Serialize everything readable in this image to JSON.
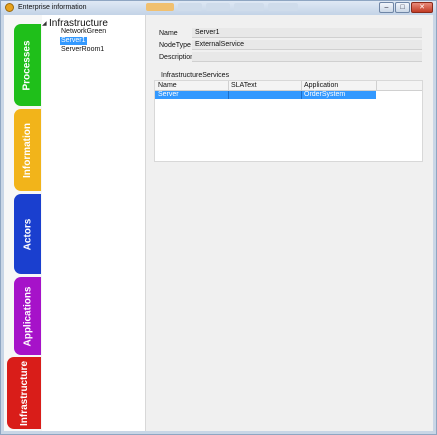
{
  "window": {
    "title": "Enterprise information",
    "icon": "app-icon",
    "controls": {
      "minimize": "–",
      "maximize": "□",
      "close": "✕"
    },
    "colors": {
      "titlebar": "#c9d6e6",
      "close": "#c23b24"
    }
  },
  "sidebar": {
    "tabs": [
      {
        "label": "Processes",
        "color": "#1fbf1a"
      },
      {
        "label": "Information",
        "color": "#f2b41a"
      },
      {
        "label": "Actors",
        "color": "#1a3fcf"
      },
      {
        "label": "Applications",
        "color": "#a612c9"
      },
      {
        "label": "Infrastructure",
        "color": "#d91d19"
      }
    ],
    "active_tab": "Infrastructure"
  },
  "tree": {
    "root": "Infrastructure",
    "expand_icon": "expanded-triangle-icon",
    "children": [
      "NetworkGreen",
      "Server1",
      "ServerRoom1"
    ],
    "selected": "Server1"
  },
  "details": {
    "fields": [
      {
        "label": "Name",
        "value": "Server1"
      },
      {
        "label": "NodeType",
        "value": "ExternalService"
      },
      {
        "label": "Description",
        "value": ""
      }
    ]
  },
  "services": {
    "caption": "InfrastructureServices",
    "columns": [
      "Name",
      "SLAText",
      "Application"
    ],
    "rows": [
      {
        "name": "Server",
        "sla": "",
        "application": "OrderSystem",
        "selected": true
      }
    ],
    "selection_color": "#3399ff"
  }
}
